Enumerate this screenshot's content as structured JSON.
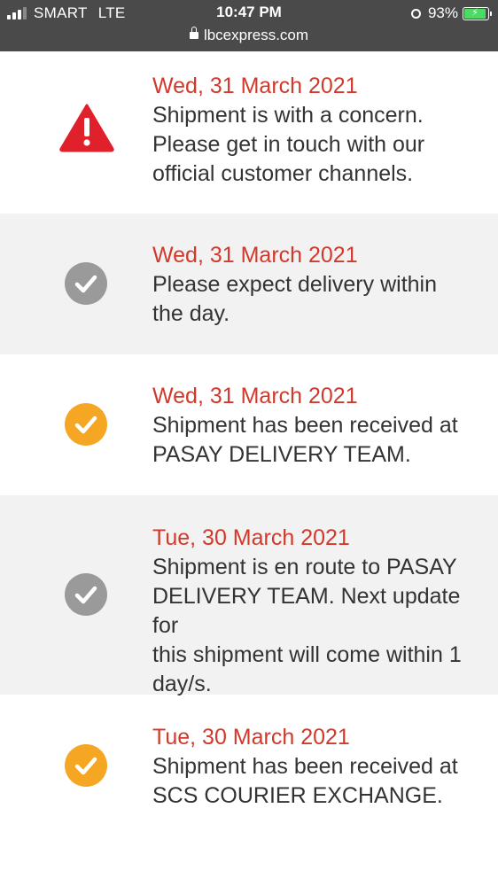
{
  "status_bar": {
    "carrier": "SMART",
    "network": "LTE",
    "time": "10:47 PM",
    "url": "lbcexpress.com",
    "battery_percent": "93%",
    "battery_level": 0.93
  },
  "colors": {
    "date_red": "#d0392b",
    "alert_red": "#e0202b",
    "check_gray": "#9a9a9a",
    "check_orange": "#f5a623",
    "row_shade": "#f2f2f2"
  },
  "timeline": [
    {
      "status_icon": "alert-triangle-icon",
      "date": "Wed, 31 March 2021",
      "lines": [
        "Shipment is with a concern.",
        "Please get in touch with our",
        "official customer channels."
      ]
    },
    {
      "status_icon": "gray-check-icon",
      "date": "Wed, 31 March 2021",
      "lines": [
        "Please expect delivery within",
        "the day."
      ]
    },
    {
      "status_icon": "orange-check-icon",
      "date": "Wed, 31 March 2021",
      "lines": [
        "Shipment has been received at",
        "PASAY DELIVERY TEAM."
      ]
    },
    {
      "status_icon": "gray-check-icon",
      "date": "Tue, 30 March 2021",
      "lines": [
        "Shipment is en route to PASAY",
        "DELIVERY TEAM. Next update for",
        "this shipment will come within 1",
        "day/s."
      ]
    },
    {
      "status_icon": "orange-check-icon",
      "date": "Tue, 30 March 2021",
      "lines": [
        "Shipment has been received at",
        "SCS COURIER EXCHANGE."
      ]
    }
  ]
}
